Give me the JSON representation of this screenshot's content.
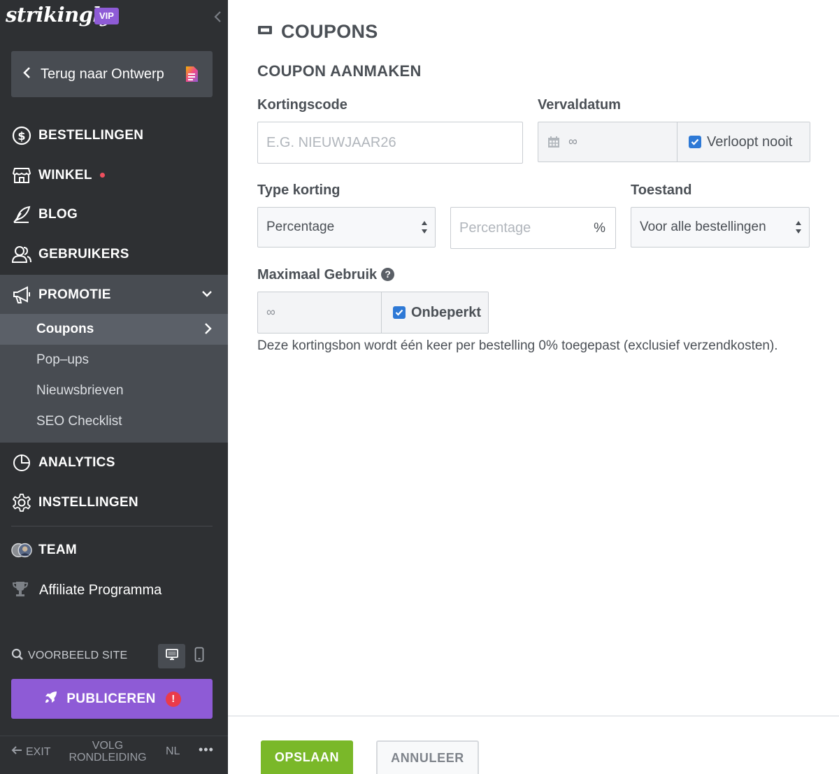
{
  "brand": {
    "logo": "strikingly",
    "badge": "VIP"
  },
  "sidebar": {
    "back_label": "Terug naar Ontwerp",
    "nav": [
      {
        "label": "BESTELLINGEN",
        "icon": "dollar-circle-icon"
      },
      {
        "label": "WINKEL",
        "icon": "store-icon",
        "has_dot": true
      },
      {
        "label": "BLOG",
        "icon": "quill-icon"
      },
      {
        "label": "GEBRUIKERS",
        "icon": "users-icon"
      }
    ],
    "promotie": {
      "label": "PROMOTIE",
      "icon": "megaphone-icon",
      "items": [
        "Coupons",
        "Pop–ups",
        "Nieuwsbrieven",
        "SEO Checklist"
      ],
      "active": "Coupons"
    },
    "nav2": [
      {
        "label": "ANALYTICS",
        "icon": "pie-chart-icon"
      },
      {
        "label": "INSTELLINGEN",
        "icon": "gear-icon"
      },
      {
        "label": "TEAM",
        "icon": "team-avatars-icon"
      }
    ],
    "affiliate_label": "Affiliate Programma",
    "preview_label": "VOORBEELD SITE",
    "publish_label": "PUBLICEREN",
    "alert_mark": "!",
    "footer": {
      "exit": "EXIT",
      "tour": "VOLG RONDLEIDING",
      "lang": "NL",
      "more": "•••"
    }
  },
  "main": {
    "title": "COUPONS",
    "subtitle": "COUPON AANMAKEN",
    "code": {
      "label": "Kortingscode",
      "placeholder": "E.G. NIEUWJAAR26",
      "value": ""
    },
    "expiry": {
      "label": "Vervaldatum",
      "value": "∞",
      "never_label": "Verloopt nooit",
      "never_checked": true
    },
    "type": {
      "label": "Type korting",
      "selected": "Percentage",
      "amount_placeholder": "Percentage",
      "unit": "%"
    },
    "condition": {
      "label": "Toestand",
      "selected": "Voor alle bestellingen"
    },
    "max_usage": {
      "label": "Maximaal Gebruik",
      "value": "∞",
      "unlimited_label": "Onbeperkt",
      "unlimited_checked": true,
      "help": "?"
    },
    "note": "Deze kortingsbon wordt één keer per bestelling 0% toegepast (exclusief verzendkosten).",
    "save_label": "OPSLAAN",
    "cancel_label": "ANNULEER"
  },
  "colors": {
    "sidebar_bg": "#2e3033",
    "sidebar_active": "#484c52",
    "brand_purple": "#8e5bd6",
    "save_green": "#7ab829",
    "checkbox_blue": "#2e79d6",
    "alert_red": "#ea3b4a"
  }
}
